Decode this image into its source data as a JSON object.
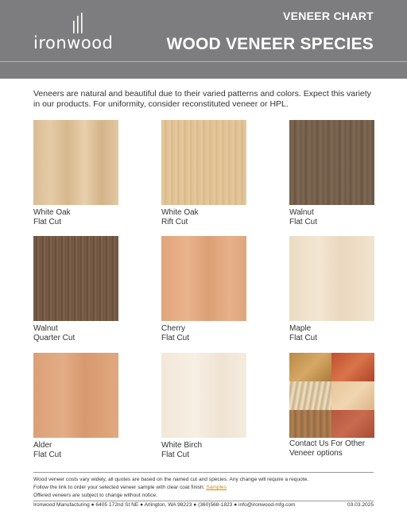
{
  "header": {
    "logo_text": "ironwood",
    "subtitle": "VENEER CHART",
    "title": "WOOD VENEER SPECIES",
    "colors": {
      "band": "#7d7d7f",
      "text": "#ffffff"
    }
  },
  "intro": "Veneers are natural and beautiful due to their varied patterns and colors. Expect this variety in our products. For uniformity, consider reconstituted veneer or HPL.",
  "swatches": [
    {
      "line1": "White Oak",
      "line2": "Flat Cut",
      "color": "#deC39c"
    },
    {
      "line1": "White Oak",
      "line2": "Rift Cut",
      "color": "#e0c294"
    },
    {
      "line1": "Walnut",
      "line2": "Flat Cut",
      "color": "#76614d"
    },
    {
      "line1": "Walnut",
      "line2": "Quarter Cut",
      "color": "#735843"
    },
    {
      "line1": "Cherry",
      "line2": "Flat Cut",
      "color": "#e3aa81"
    },
    {
      "line1": "Maple",
      "line2": "Flat Cut",
      "color": "#efe0c9"
    },
    {
      "line1": "Alder",
      "line2": "Flat Cut",
      "color": "#dda37a"
    },
    {
      "line1": "White Birch",
      "line2": "Flat Cut",
      "color": "#f4ebde"
    },
    {
      "line1": "Contact Us For Other",
      "line2": "Veneer options",
      "color": "#c98a5a"
    }
  ],
  "footer": {
    "note1": "Wood veneer costs vary widely, all quotes are based on the named cut and species. Any change will require a requote.",
    "note2_prefix": "Follow the link to order your selected veneer sample with clear coat finish: ",
    "note2_link": "Samples",
    "note3": "Offered veneers are subject to change without notice.",
    "address": "Ironwood Manufacturing  ●  6405 172nd St NE  ●  Arlington, WA 98223  ●  (360)568-1823  ●  info@ironwood-mfg.com",
    "date": "03.03.2025",
    "link_color": "#c98a1d"
  }
}
